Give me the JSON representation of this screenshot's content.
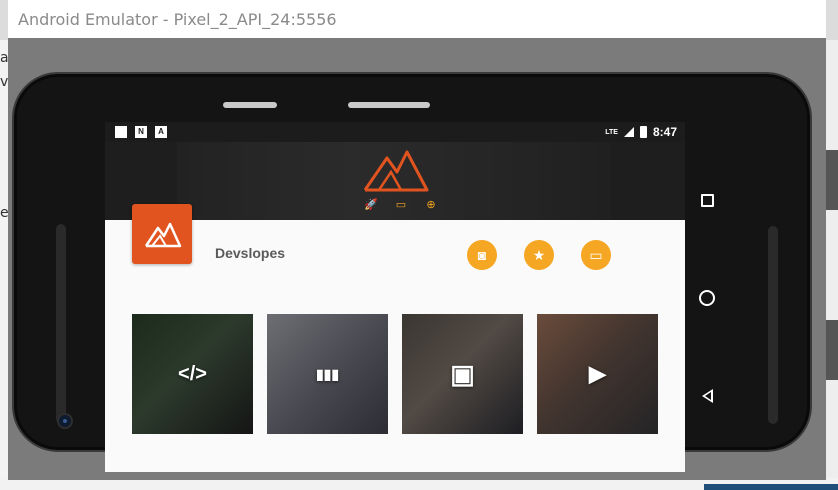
{
  "window": {
    "title": "Android Emulator - Pixel_2_API_24:5556"
  },
  "status_bar": {
    "left_icons": [
      "sd-card-icon",
      "n-notification-icon",
      "a-notification-icon"
    ],
    "right_icons": [
      "lte-icon",
      "signal-icon",
      "battery-icon"
    ],
    "time": "8:47"
  },
  "header": {
    "logo_icon": "mountain-logo-icon",
    "categories": [
      {
        "icon": "rocket-icon",
        "glyph": "🚀"
      },
      {
        "icon": "monitor-icon",
        "glyph": "▭"
      },
      {
        "icon": "gamepad-icon",
        "glyph": "⊕"
      }
    ]
  },
  "profile": {
    "avatar_icon": "mountain-avatar-icon",
    "name": "Devslopes"
  },
  "actions": [
    {
      "icon": "camera-icon",
      "glyph": "◙"
    },
    {
      "icon": "star-icon",
      "glyph": "★"
    },
    {
      "icon": "inbox-icon",
      "glyph": "▭"
    }
  ],
  "tiles": [
    {
      "icon": "code-icon",
      "glyph": "</>"
    },
    {
      "icon": "chart-icon",
      "glyph": "▮▮▮"
    },
    {
      "icon": "image-icon",
      "glyph": "▣"
    },
    {
      "icon": "video-icon",
      "glyph": "▶"
    }
  ],
  "nav_buttons": [
    "recents-button",
    "home-button",
    "back-button"
  ],
  "colors": {
    "accent_orange": "#E2541F",
    "action_yellow": "#F5A623",
    "header_dark": "#1E1E1E"
  }
}
